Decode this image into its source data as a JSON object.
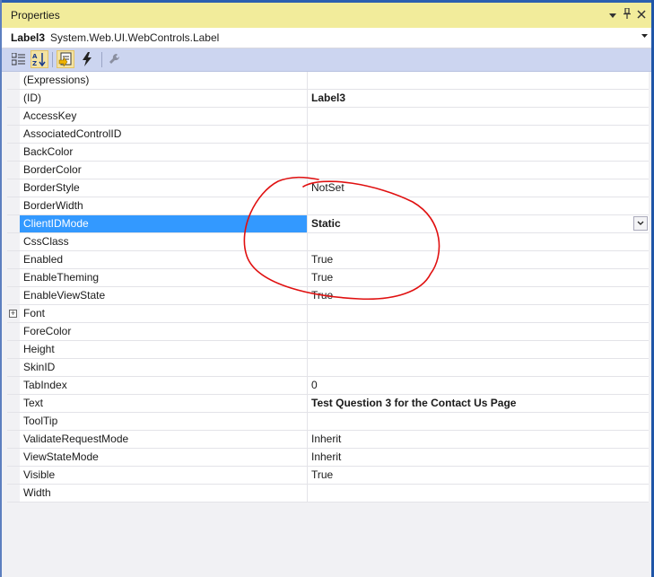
{
  "panel": {
    "title": "Properties"
  },
  "object_selector": {
    "name": "Label3",
    "type": "System.Web.UI.WebControls.Label"
  },
  "toolbar": {
    "buttons": [
      "categorized-icon",
      "alphabetical-icon",
      "properties-icon",
      "events-icon",
      "property-pages-icon"
    ]
  },
  "properties": [
    {
      "name": "(Expressions)",
      "value": ""
    },
    {
      "name": "(ID)",
      "value": "Label3"
    },
    {
      "name": "AccessKey",
      "value": ""
    },
    {
      "name": "AssociatedControlID",
      "value": ""
    },
    {
      "name": "BackColor",
      "value": ""
    },
    {
      "name": "BorderColor",
      "value": ""
    },
    {
      "name": "BorderStyle",
      "value": "NotSet"
    },
    {
      "name": "BorderWidth",
      "value": ""
    },
    {
      "name": "ClientIDMode",
      "value": "Static"
    },
    {
      "name": "CssClass",
      "value": ""
    },
    {
      "name": "Enabled",
      "value": "True"
    },
    {
      "name": "EnableTheming",
      "value": "True"
    },
    {
      "name": "EnableViewState",
      "value": "True"
    },
    {
      "name": "Font",
      "value": ""
    },
    {
      "name": "ForeColor",
      "value": ""
    },
    {
      "name": "Height",
      "value": ""
    },
    {
      "name": "SkinID",
      "value": ""
    },
    {
      "name": "TabIndex",
      "value": "0"
    },
    {
      "name": "Text",
      "value": "Test Question 3 for the Contact Us Page"
    },
    {
      "name": "ToolTip",
      "value": ""
    },
    {
      "name": "ValidateRequestMode",
      "value": "Inherit"
    },
    {
      "name": "ViewStateMode",
      "value": "Inherit"
    },
    {
      "name": "Visible",
      "value": "True"
    },
    {
      "name": "Width",
      "value": ""
    }
  ],
  "colors": {
    "title_bg": "#f2ec9b",
    "toolbar_bg": "#ccd5f0",
    "selection": "#3399ff",
    "annotation": "#e01010"
  }
}
